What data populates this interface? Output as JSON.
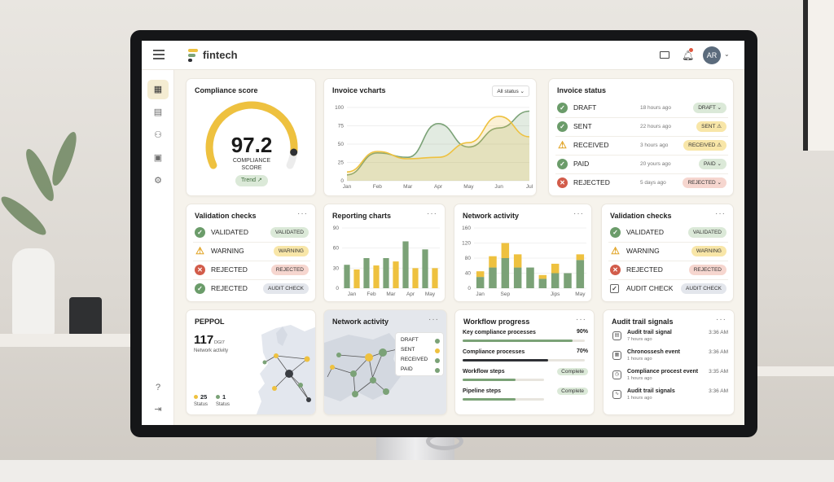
{
  "app": {
    "brand": "fintech",
    "avatar_initials": "AR",
    "brand_colors": {
      "green": "#7ba277",
      "yellow": "#eec13f",
      "dark": "#2f3135"
    }
  },
  "topbar": {
    "menu_icon": "hamburger-icon",
    "mail_icon": "mail-icon",
    "bell_icon": "bell-icon"
  },
  "sidebar": {
    "items": [
      {
        "icon": "grid-icon",
        "active": true
      },
      {
        "icon": "document-icon",
        "active": false
      },
      {
        "icon": "users-icon",
        "active": false
      },
      {
        "icon": "calendar-icon",
        "active": false
      },
      {
        "icon": "settings-icon",
        "active": false
      }
    ],
    "bottom": [
      {
        "icon": "help-icon"
      },
      {
        "icon": "logout-icon"
      }
    ]
  },
  "compliance": {
    "title": "Compliance score",
    "score": "97.2",
    "label_line1": "COMPLIANCE",
    "label_line2": "SCORE",
    "score_fraction": 0.92,
    "trend_label": "Trend ↗"
  },
  "invoice_charts": {
    "title": "Invoice vcharts",
    "filter": "All status ⌄",
    "chart_data": {
      "type": "area",
      "x": [
        "Jan",
        "Feb",
        "Mar",
        "Apr",
        "May",
        "Jun",
        "Jul"
      ],
      "yticks": [
        0,
        25,
        50,
        75,
        100
      ],
      "ylim": [
        0,
        100
      ],
      "series": [
        {
          "color": "#7ba277",
          "values": [
            8,
            38,
            32,
            78,
            46,
            72,
            95
          ]
        },
        {
          "color": "#eec13f",
          "values": [
            12,
            40,
            30,
            32,
            52,
            88,
            60
          ]
        }
      ]
    }
  },
  "invoice_status": {
    "title": "Invoice status",
    "rows": [
      {
        "status": "ok",
        "label": "DRAFT",
        "time": "18 hours ago",
        "pill": "DRAFT ⌄",
        "pill_class": "p-green"
      },
      {
        "status": "ok",
        "label": "SENT",
        "time": "22 hours ago",
        "pill": "SENT ⚠",
        "pill_class": "p-yellow"
      },
      {
        "status": "warn",
        "label": "RECEIVED",
        "time": "3 hours ago",
        "pill": "RECEIVED ⚠",
        "pill_class": "p-yellow"
      },
      {
        "status": "ok",
        "label": "PAID",
        "time": "20 yours ago",
        "pill": "PAID ⌄",
        "pill_class": "p-green"
      },
      {
        "status": "rej",
        "label": "REJECTED",
        "time": "5 days ago",
        "pill": "REJECTED ⌄",
        "pill_class": "p-red"
      }
    ]
  },
  "validation_left": {
    "title": "Validation checks",
    "rows": [
      {
        "status": "ok",
        "label": "VALIDATED",
        "pill": "VALIDATED",
        "pill_class": "p-green"
      },
      {
        "status": "warn",
        "label": "WARNING",
        "pill": "WARNING",
        "pill_class": "p-yellow"
      },
      {
        "status": "rej",
        "label": "REJECTED",
        "pill": "REJECTED",
        "pill_class": "p-red"
      },
      {
        "status": "ok",
        "label": "REJECTED",
        "pill": "AUDIT CHECK",
        "pill_class": "p-gray"
      }
    ]
  },
  "reporting": {
    "title": "Reporting charts",
    "chart_data": {
      "type": "bar",
      "categories": [
        "Jan",
        "",
        "Feb",
        "",
        "Mar",
        "",
        "Apr",
        "",
        "May",
        ""
      ],
      "xticks": [
        "Jan",
        "Feb",
        "Mar",
        "Apr",
        "May"
      ],
      "yticks": [
        0,
        30,
        60,
        90
      ],
      "ylim": [
        0,
        90
      ],
      "series": [
        {
          "color": "#7ba277",
          "values": [
            35,
            28,
            45,
            34,
            45,
            40,
            70,
            30,
            58,
            30
          ]
        },
        {
          "color": "#eec13f",
          "values": [
            0,
            0,
            0,
            0,
            0,
            0,
            0,
            0,
            0,
            0
          ]
        }
      ],
      "bar_colors": [
        "#7ba277",
        "#eec13f",
        "#7ba277",
        "#eec13f",
        "#7ba277",
        "#eec13f",
        "#7ba277",
        "#eec13f",
        "#7ba277",
        "#eec13f"
      ]
    }
  },
  "network_activity": {
    "title": "Network activity",
    "chart_data": {
      "type": "bar",
      "categories": [
        "Jan",
        "",
        "Sep",
        "",
        "",
        "",
        "Jips",
        "",
        "May"
      ],
      "xticks": [
        "Jan",
        "Sep",
        "Jips",
        "May"
      ],
      "yticks": [
        0,
        40,
        80,
        120,
        160
      ],
      "ylim": [
        0,
        160
      ],
      "series": [
        {
          "name": "green",
          "color": "#7ba277",
          "values": [
            30,
            55,
            80,
            55,
            55,
            25,
            40,
            40,
            75
          ]
        },
        {
          "name": "yellow",
          "color": "#eec13f",
          "values": [
            15,
            30,
            40,
            35,
            0,
            10,
            25,
            0,
            15
          ]
        }
      ]
    }
  },
  "validation_right": {
    "title": "Validation checks",
    "rows": [
      {
        "status": "ok",
        "label": "VALIDATED",
        "pill": "VALIDATED",
        "pill_class": "p-green"
      },
      {
        "status": "warn",
        "label": "WARNING",
        "pill": "WARNING",
        "pill_class": "p-yellow"
      },
      {
        "status": "rej",
        "label": "REJECTED",
        "pill": "REJECTED",
        "pill_class": "p-red"
      },
      {
        "status": "audit",
        "label": "AUDIT CHECK",
        "pill": "AUDIT CHECK",
        "pill_class": "p-gray"
      }
    ]
  },
  "peppol": {
    "title": "PEPPOL",
    "count": "117",
    "count_unit": "DGI7",
    "count_label": "Network activity",
    "stat1_value": "25",
    "stat1_label": "Status",
    "stat2_value": "1",
    "stat2_label": "Status"
  },
  "network_map": {
    "title": "Network activity",
    "legend": [
      {
        "label": "DRAFT",
        "color": "#7ba277"
      },
      {
        "label": "SENT",
        "color": "#eec13f"
      },
      {
        "label": "RECEIVED",
        "color": "#7ba277"
      },
      {
        "label": "PAID",
        "color": "#7ba277"
      }
    ]
  },
  "workflow": {
    "title": "Workflow progress",
    "items": [
      {
        "label": "Key compliance processes",
        "value": "90%",
        "fraction": 0.9,
        "color": "#7ba277"
      },
      {
        "label": "Compliance processes",
        "value": "70%",
        "fraction": 0.7,
        "color": "#2f3135"
      },
      {
        "label": "Workflow steps",
        "value": "Complete",
        "fraction": 0.65,
        "color": "#7ba277"
      },
      {
        "label": "Pipeline steps",
        "value": "Complete",
        "fraction": 0.65,
        "color": "#7ba277"
      }
    ]
  },
  "audit": {
    "title": "Audit trail signals",
    "items": [
      {
        "icon": "audit-icon",
        "glyph": "▤",
        "title": "Audit trail signal",
        "sub": "7 hours ago",
        "time": "3:36 AM"
      },
      {
        "icon": "calendar-icon",
        "glyph": "▦",
        "title": "Chronossesh event",
        "sub": "1 hours ago",
        "time": "3:36 AM"
      },
      {
        "icon": "clock-icon",
        "glyph": "◷",
        "title": "Compliance procest event",
        "sub": "1 hours ago",
        "time": "3:35 AM"
      },
      {
        "icon": "pulse-icon",
        "glyph": "∿",
        "title": "Audit trail signals",
        "sub": "1 hours ago",
        "time": "3:36 AM"
      }
    ]
  }
}
